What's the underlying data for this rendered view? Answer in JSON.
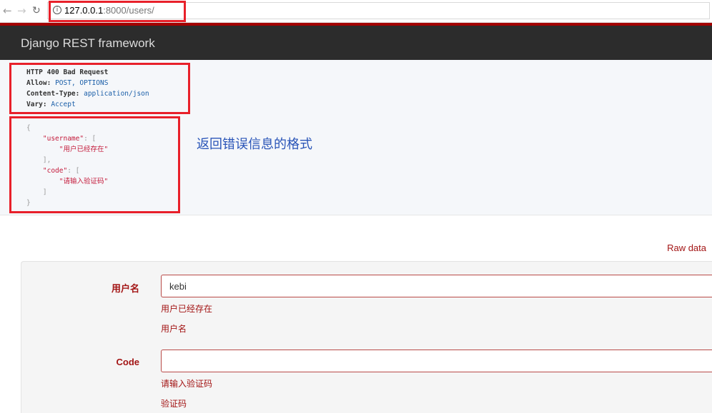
{
  "browser": {
    "url_host": "127.0.0.1",
    "url_rest": ":8000/users/",
    "info_glyph": "i"
  },
  "navbar": {
    "brand": "Django REST framework"
  },
  "response": {
    "headers": [
      {
        "key": "HTTP 400 Bad Request",
        "value": ""
      },
      {
        "key": "Allow:",
        "value": "POST, OPTIONS"
      },
      {
        "key": "Content-Type:",
        "value": "application/json"
      },
      {
        "key": "Vary:",
        "value": "Accept"
      }
    ],
    "body": {
      "open_brace": "{",
      "username_key": "\"username\"",
      "open_bracket": ": [",
      "username_error": "\"用户已经存在\"",
      "close_bracket_comma": "],",
      "code_key": "\"code\"",
      "code_error": "\"请输入验证码\"",
      "close_bracket": "]",
      "close_brace": "}"
    },
    "annotation": "返回错误信息的格式"
  },
  "raw_data_label": "Raw data",
  "form": {
    "username": {
      "label": "用户名",
      "value": "kebi",
      "error": "用户已经存在",
      "help": "用户名"
    },
    "code": {
      "label": "Code",
      "value": "",
      "error": "请输入验证码",
      "help": "验证码"
    }
  },
  "colors": {
    "highlight": "#e8202a",
    "navbar": "#2c2c2c",
    "navbar_accent": "#a30000",
    "error": "#a31515",
    "annotation": "#2a55b8"
  }
}
